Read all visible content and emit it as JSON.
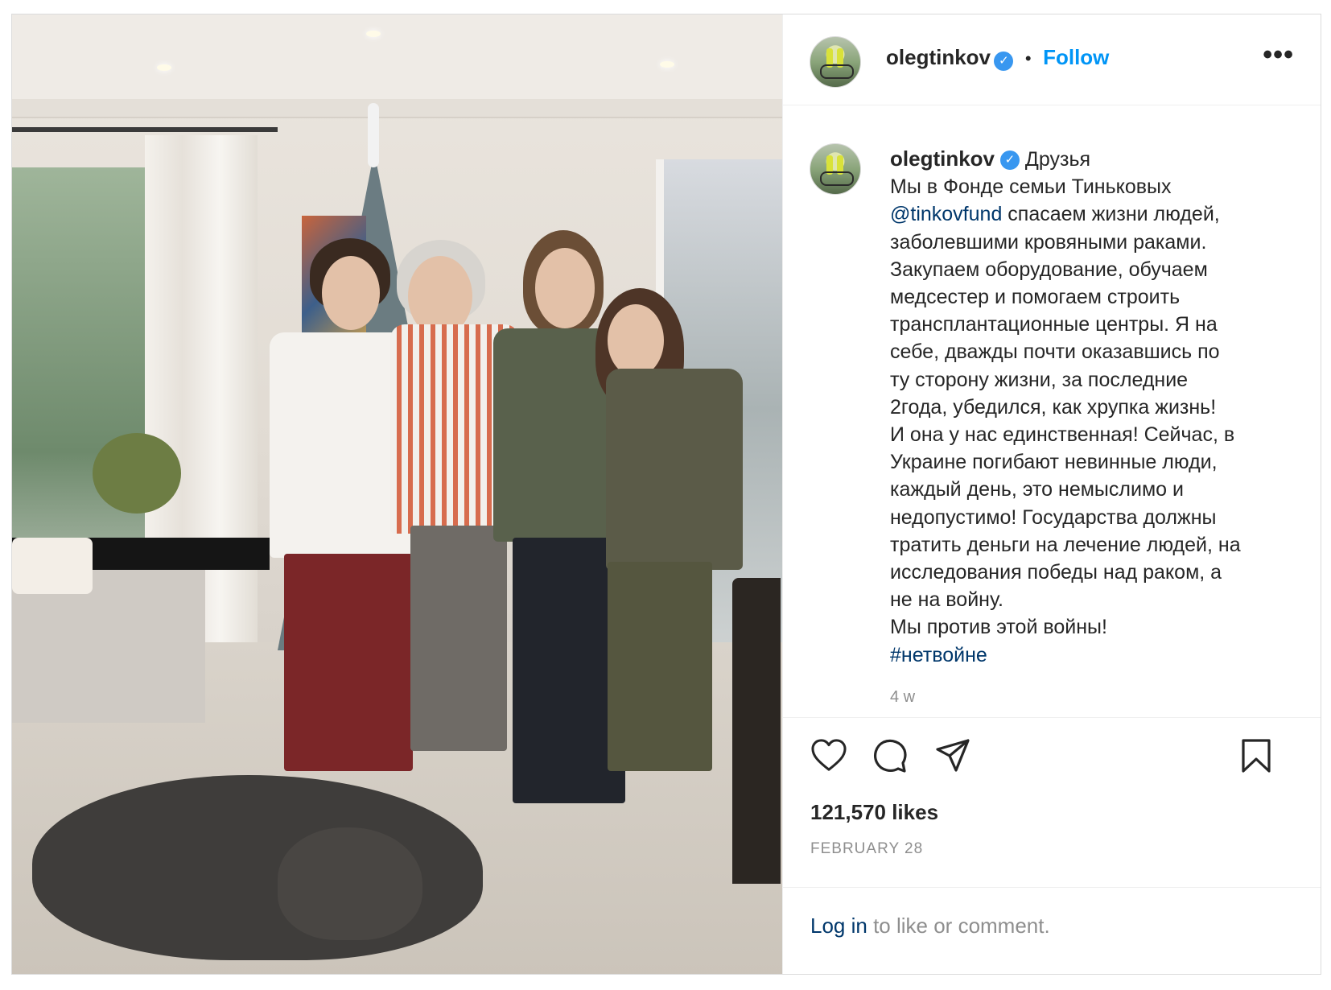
{
  "header": {
    "username": "olegtinkov",
    "separator": "•",
    "follow_label": "Follow",
    "more_label": "•••"
  },
  "caption": {
    "username": "olegtinkov",
    "first_word": "Друзья",
    "lines": [
      "Мы в Фонде семьи Тиньковых",
      "спасаем жизни людей,",
      "заболевшими кровяными раками.",
      "Закупаем оборудование, обучаем",
      "медсестер и помогаем строить",
      "трансплантационные центры. Я на",
      "себе, дважды почти оказавшись по",
      "ту сторону жизни, за последние",
      "2года, убедился, как хрупка жизнь!",
      "И она у нас единственная! Сейчас, в",
      "Украине погибают невинные люди,",
      "каждый день, это немыслимо и",
      "недопустимо! Государства должны",
      "тратить деньги на лечение людей, на",
      "исследования победы над раком, а",
      "не на войну.",
      "Мы против этой войны!"
    ],
    "mention": "@tinkovfund",
    "hashtag": "#нетвойне",
    "time_ago": "4 w"
  },
  "actions": {
    "like_icon": "heart-icon",
    "comment_icon": "comment-icon",
    "share_icon": "paper-plane-icon",
    "save_icon": "bookmark-icon"
  },
  "likes": "121,570 likes",
  "date": "FEBRUARY 28",
  "login": {
    "link": "Log in",
    "rest": "to like or comment."
  },
  "colors": {
    "follow": "#0095f6",
    "link": "#00376b",
    "verified": "#3897f0",
    "muted": "#8e8e8e"
  }
}
